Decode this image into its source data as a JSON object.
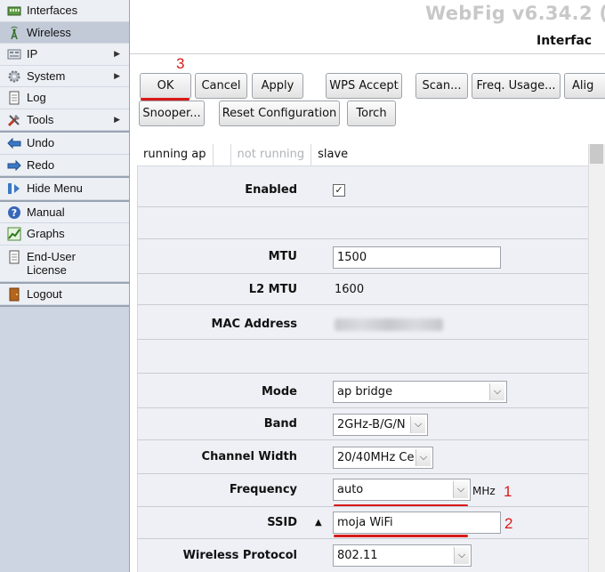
{
  "app": {
    "title": "WebFig v6.34.2 (",
    "section_title": "Interfac"
  },
  "sidebar": {
    "items": [
      {
        "label": "Interfaces",
        "icon": "interfaces-icon",
        "has_submenu": false
      },
      {
        "label": "Wireless",
        "icon": "wireless-antenna-icon",
        "has_submenu": false,
        "active": true
      },
      {
        "label": "IP",
        "icon": "ip-icon",
        "has_submenu": true
      },
      {
        "label": "System",
        "icon": "gear-icon",
        "has_submenu": true
      },
      {
        "label": "Log",
        "icon": "document-icon",
        "has_submenu": false
      },
      {
        "label": "Tools",
        "icon": "tools-icon",
        "has_submenu": true
      },
      {
        "label": "Undo",
        "icon": "undo-icon",
        "has_submenu": false
      },
      {
        "label": "Redo",
        "icon": "redo-icon",
        "has_submenu": false
      },
      {
        "label": "Hide Menu",
        "icon": "hide-menu-icon",
        "has_submenu": false
      },
      {
        "label": "Manual",
        "icon": "help-icon",
        "has_submenu": false
      },
      {
        "label": "Graphs",
        "icon": "graph-icon",
        "has_submenu": false
      },
      {
        "label": "End-User License",
        "icon": "document-icon",
        "has_submenu": false
      },
      {
        "label": "Logout",
        "icon": "logout-door-icon",
        "has_submenu": false
      }
    ],
    "submenu_arrow": "▶"
  },
  "toolbar": {
    "ok_label": "OK",
    "cancel_label": "Cancel",
    "apply_label": "Apply",
    "wps_label": "WPS Accept",
    "scan_label": "Scan...",
    "freq_usage_label": "Freq. Usage...",
    "align_label": "Alig",
    "snooper_label": "Snooper...",
    "reset_label": "Reset Configuration",
    "torch_label": "Torch"
  },
  "status": {
    "flags": [
      "running ap",
      "",
      "not running",
      "slave"
    ]
  },
  "form": {
    "enabled_label": "Enabled",
    "enabled_checked": true,
    "check_mark": "✓",
    "mtu_label": "MTU",
    "mtu_value": "1500",
    "l2mtu_label": "L2 MTU",
    "l2mtu_value": "1600",
    "mac_label": "MAC Address",
    "mode_label": "Mode",
    "mode_value": "ap bridge",
    "band_label": "Band",
    "band_value": "2GHz-B/G/N",
    "channel_width_label": "Channel Width",
    "channel_width_value": "20/40MHz Ce",
    "frequency_label": "Frequency",
    "frequency_value": "auto",
    "frequency_unit": "MHz",
    "ssid_label": "SSID",
    "ssid_value": "moja WiFi",
    "ssid_collapse": "▲",
    "wireless_protocol_label": "Wireless Protocol",
    "wireless_protocol_value": "802.11",
    "dropdown_arrow": "⌵"
  },
  "annotations": {
    "step_ok": "3",
    "step_frequency": "1",
    "step_ssid": "2"
  },
  "colors": {
    "annotation_red": "#d81a1a",
    "sidebar_bg": "#cdd5e2",
    "panel_bg": "#eef0f5"
  }
}
